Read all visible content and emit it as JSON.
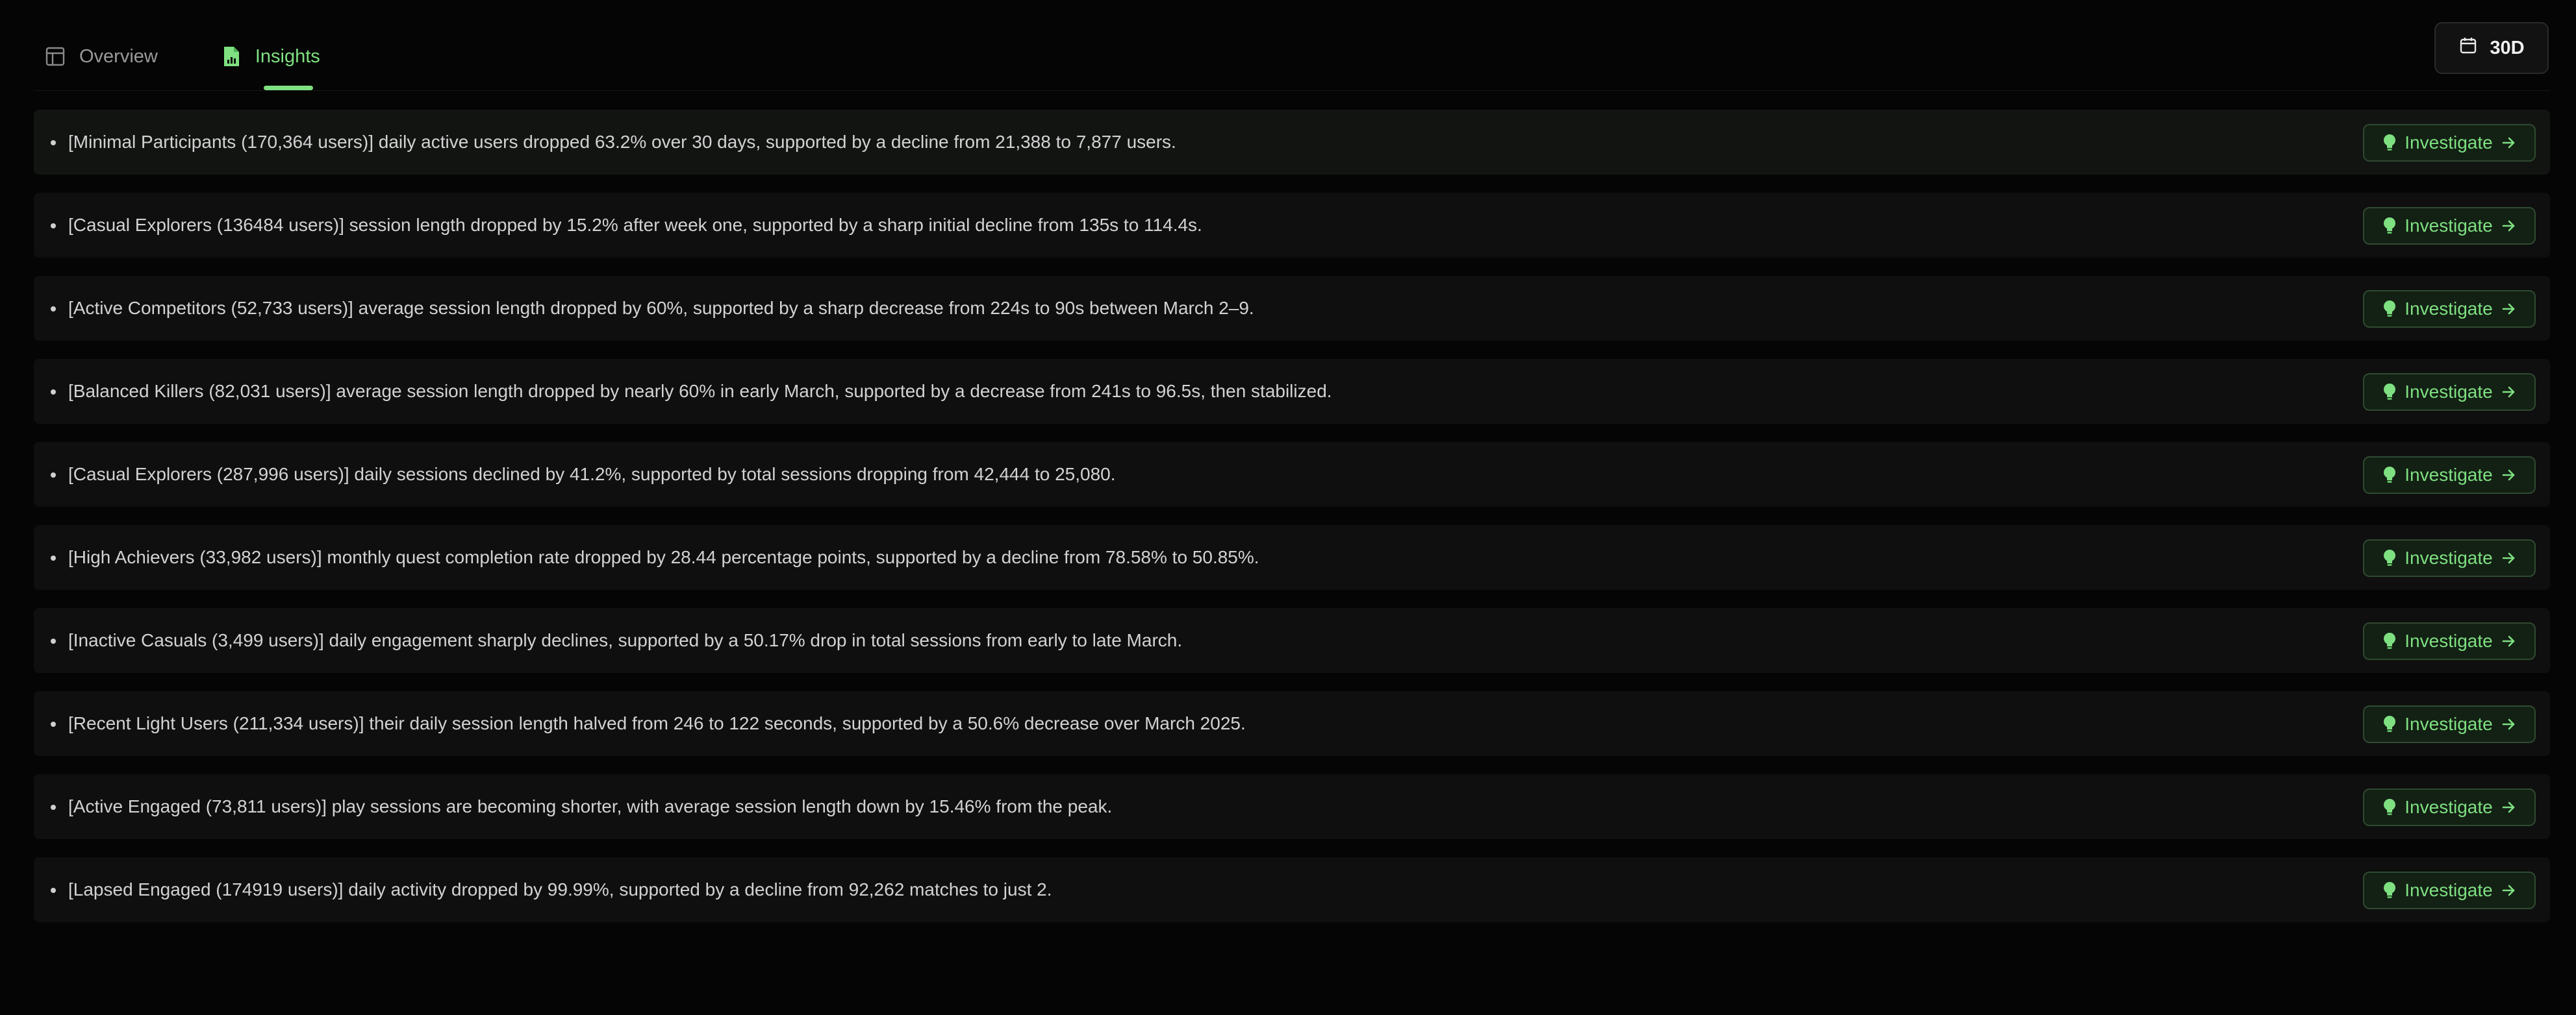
{
  "tabs": [
    {
      "label": "Overview",
      "icon": "layout-icon",
      "active": false
    },
    {
      "label": "Insights",
      "icon": "file-chart-icon",
      "active": true
    }
  ],
  "range": {
    "label": "30D",
    "icon": "calendar-icon"
  },
  "accent_color": "#7ee081",
  "insight_button_label": "Investigate",
  "insights": [
    {
      "text": "[Minimal Participants (170,364 users)] daily active users dropped 63.2% over 30 days, supported by a decline from 21,388 to 7,877 users."
    },
    {
      "text": "[Casual Explorers (136484 users)] session length dropped by 15.2% after week one, supported by a sharp initial decline from 135s to 114.4s."
    },
    {
      "text": "[Active Competitors (52,733 users)] average session length dropped by 60%, supported by a sharp decrease from 224s to 90s between March 2–9."
    },
    {
      "text": "[Balanced Killers (82,031 users)] average session length dropped by nearly 60% in early March, supported by a decrease from 241s to 96.5s, then stabilized."
    },
    {
      "text": "[Casual Explorers (287,996 users)] daily sessions declined by 41.2%, supported by total sessions dropping from 42,444 to 25,080."
    },
    {
      "text": "[High Achievers (33,982 users)] monthly quest completion rate dropped by 28.44 percentage points, supported by a decline from 78.58% to 50.85%."
    },
    {
      "text": "[Inactive Casuals (3,499 users)] daily engagement sharply declines, supported by a 50.17% drop in total sessions from early to late March."
    },
    {
      "text": "[Recent Light Users (211,334 users)] their daily session length halved from 246 to 122 seconds, supported by a 50.6% decrease over March 2025."
    },
    {
      "text": "[Active Engaged (73,811 users)] play sessions are becoming shorter, with average session length down by 15.46% from the peak."
    },
    {
      "text": "[Lapsed Engaged (174919 users)] daily activity dropped by 99.99%, supported by a decline from 92,262 matches to just 2."
    }
  ]
}
